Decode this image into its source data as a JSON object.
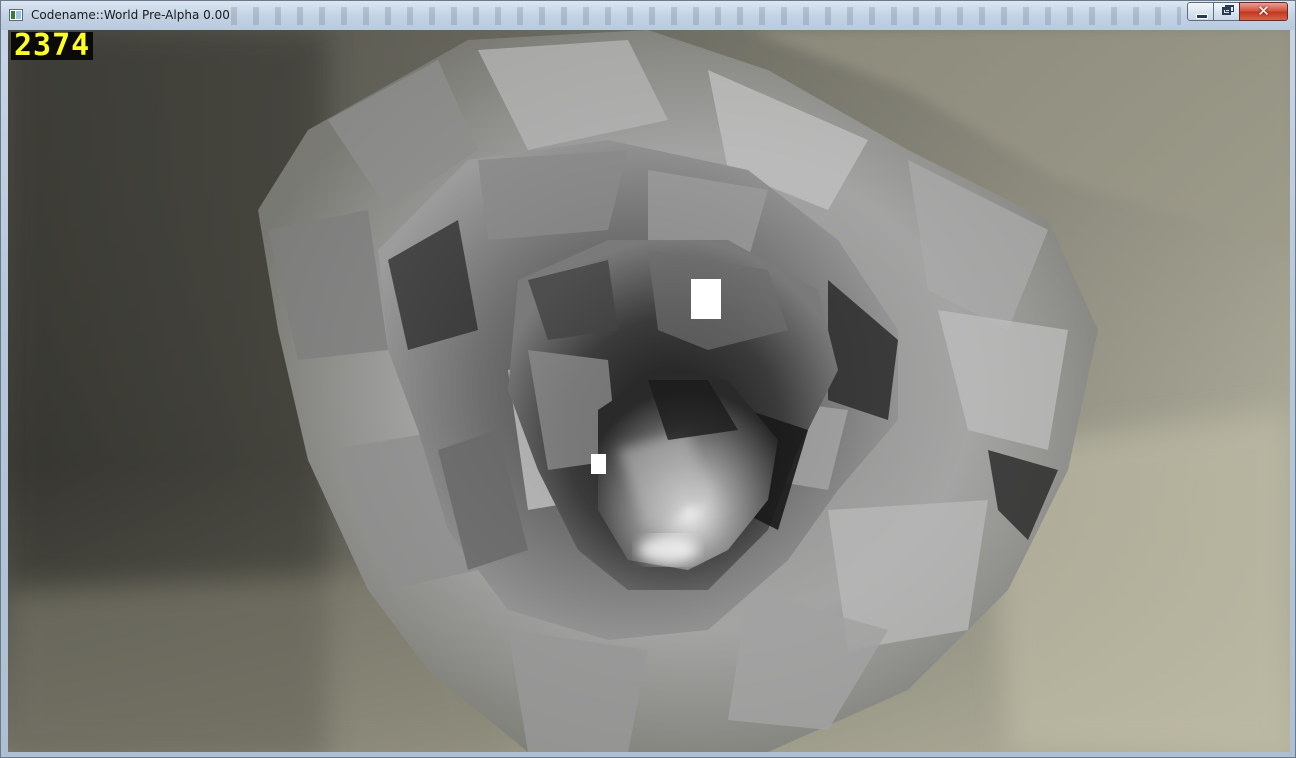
{
  "window": {
    "title": "Codename::World Pre-Alpha 0.00",
    "controls": {
      "minimize_icon": "minimize-icon",
      "maximize_icon": "restore-icon",
      "close_icon": "close-icon",
      "close_glyph": "✕"
    }
  },
  "hud": {
    "fps_counter": "2374",
    "fps_color": "#ffff22"
  },
  "scene": {
    "description_colors": {
      "cave_wall": "#9a9a9a",
      "ambient": "#8c8c7a",
      "deep_shadow": "#1e1e1e",
      "highlight": "#ffffff"
    }
  }
}
